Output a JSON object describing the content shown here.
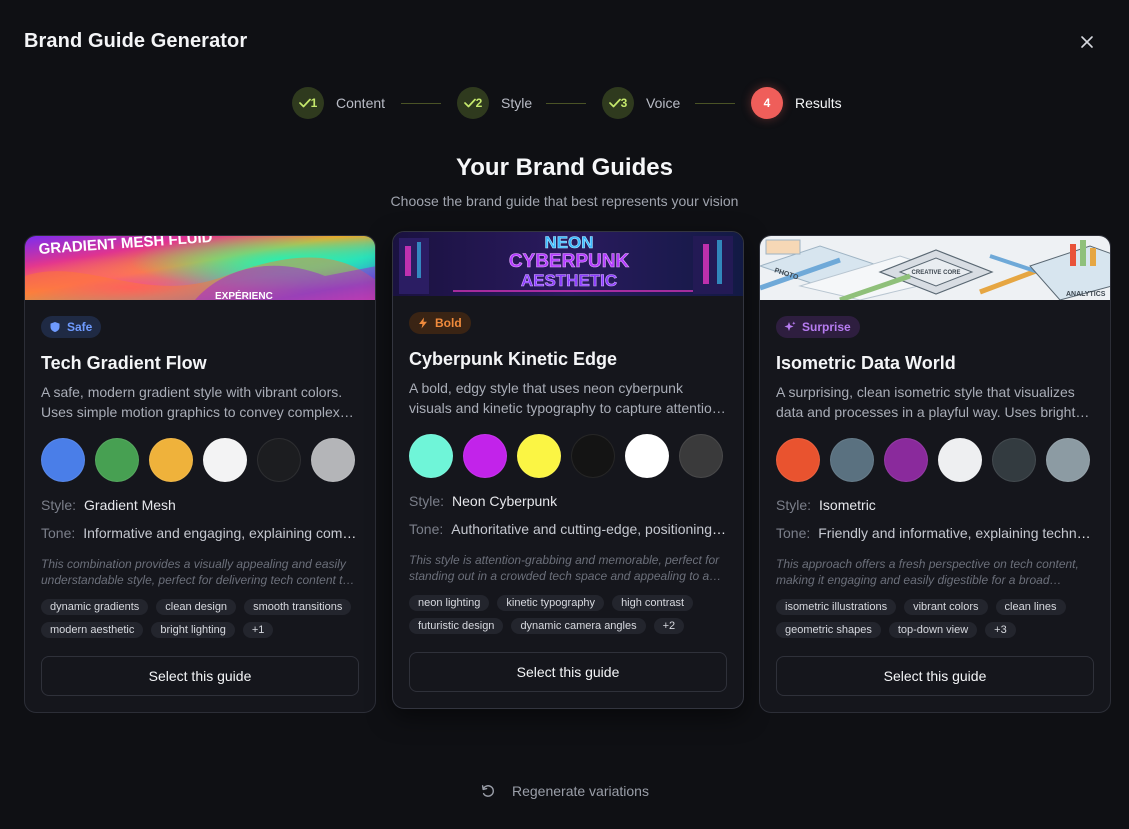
{
  "header": {
    "title": "Brand Guide Generator"
  },
  "stepper": {
    "steps": [
      {
        "number": "1",
        "label": "Content",
        "state": "done"
      },
      {
        "number": "2",
        "label": "Style",
        "state": "done"
      },
      {
        "number": "3",
        "label": "Voice",
        "state": "done"
      },
      {
        "number": "4",
        "label": "Results",
        "state": "active"
      }
    ]
  },
  "main": {
    "title": "Your Brand Guides",
    "subtitle": "Choose the brand guide that best represents your vision"
  },
  "cards": [
    {
      "badge": "Safe",
      "badge_icon": "shield-icon",
      "image_text_1": "GRADIENT MESH FLUID",
      "image_text_2": "EXPÉRIENC",
      "title": "Tech Gradient Flow",
      "description": "A safe, modern gradient style with vibrant colors. Uses simple motion graphics to convey complex ideas in an engaging manner.",
      "colors": [
        "#4a7ee8",
        "#47a052",
        "#efb23b",
        "#f3f3f4",
        "#1c1d20",
        "#b4b5b8"
      ],
      "style_label": "Style:",
      "style_value": "Gradient Mesh",
      "tone_label": "Tone:",
      "tone_value": "Informative and engaging, explaining complex tech concepts clearly.",
      "rationale": "This combination provides a visually appealing and easily understandable style, perfect for delivering tech content to a wide audience.",
      "tags": [
        "dynamic gradients",
        "clean design",
        "smooth transitions",
        "modern aesthetic",
        "bright lighting",
        "+1"
      ],
      "button": "Select this guide"
    },
    {
      "badge": "Bold",
      "badge_icon": "lightning-icon",
      "image_text_1": "NEON",
      "image_text_2": "CYBERPUNK",
      "image_text_3": "AESTHETIC",
      "title": "Cyberpunk Kinetic Edge",
      "description": "A bold, edgy style that uses neon cyberpunk visuals and kinetic typography to capture attention and deliver a futuristic feel.",
      "colors": [
        "#6ff5d8",
        "#c223ea",
        "#fbf544",
        "#141414",
        "#ffffff",
        "#3a3a3b"
      ],
      "style_label": "Style:",
      "style_value": "Neon Cyberpunk",
      "tone_label": "Tone:",
      "tone_value": "Authoritative and cutting-edge, positioning the brand at the forefront.",
      "rationale": "This style is attention-grabbing and memorable, perfect for standing out in a crowded tech space and appealing to a younger audience.",
      "tags": [
        "neon lighting",
        "kinetic typography",
        "high contrast",
        "futuristic design",
        "dynamic camera angles",
        "+2"
      ],
      "button": "Select this guide"
    },
    {
      "badge": "Surprise",
      "badge_icon": "sparkle-icon",
      "image_text_1": "PHOTO",
      "image_text_2": "CREATIVE CORE",
      "image_text_3": "ANALYTICS",
      "title": "Isometric Data World",
      "description": "A surprising, clean isometric style that visualizes data and processes in a playful way. Uses bright colors and simple shapes.",
      "colors": [
        "#e9532f",
        "#5a7180",
        "#8a2a9c",
        "#eeeff1",
        "#333b40",
        "#8c9ba3"
      ],
      "style_label": "Style:",
      "style_value": "Isometric",
      "tone_label": "Tone:",
      "tone_value": "Friendly and informative, explaining technology in an approachable way.",
      "rationale": "This approach offers a fresh perspective on tech content, making it engaging and easily digestible for a broad audience.",
      "tags": [
        "isometric illustrations",
        "vibrant colors",
        "clean lines",
        "geometric shapes",
        "top-down view",
        "+3"
      ],
      "button": "Select this guide"
    }
  ],
  "footer": {
    "regenerate": "Regenerate variations"
  },
  "theme": {
    "accent": "#ef5e5a",
    "done": "#c5e86c",
    "background": "#0f1014"
  }
}
